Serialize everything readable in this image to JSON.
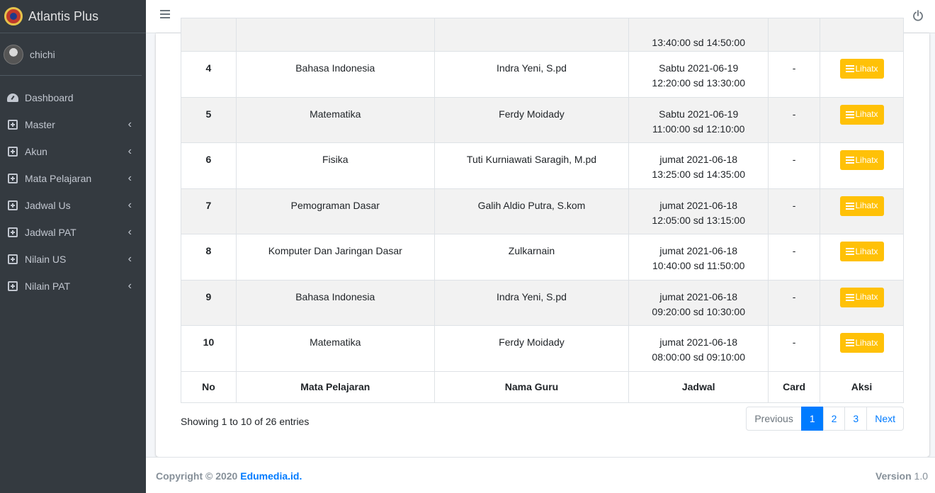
{
  "brand": {
    "title": "Atlantis Plus"
  },
  "user": {
    "name": "chichi"
  },
  "sidebar": {
    "items": [
      {
        "label": "Dashboard",
        "icon": "tachometer-icon",
        "has_chevron": false
      },
      {
        "label": "Master",
        "icon": "plus-square-icon",
        "has_chevron": true
      },
      {
        "label": "Akun",
        "icon": "plus-square-icon",
        "has_chevron": true
      },
      {
        "label": "Mata Pelajaran",
        "icon": "plus-square-icon",
        "has_chevron": true
      },
      {
        "label": "Jadwal Us",
        "icon": "plus-square-icon",
        "has_chevron": true
      },
      {
        "label": "Jadwal PAT",
        "icon": "plus-square-icon",
        "has_chevron": true
      },
      {
        "label": "Nilain US",
        "icon": "plus-square-icon",
        "has_chevron": true
      },
      {
        "label": "Nilain PAT",
        "icon": "plus-square-icon",
        "has_chevron": true
      }
    ]
  },
  "table": {
    "columns": [
      "No",
      "Mata Pelajaran",
      "Nama Guru",
      "Jadwal",
      "Card",
      "Aksi"
    ],
    "partial_row": {
      "jadwal_line2": "13:40:00 sd 14:50:00"
    },
    "rows": [
      {
        "no": "4",
        "mapel": "Bahasa Indonesia",
        "guru": "Indra Yeni, S.pd",
        "jadwal1": "Sabtu 2021-06-19",
        "jadwal2": "12:20:00 sd 13:30:00",
        "card": "-",
        "aksi": "Lihatx"
      },
      {
        "no": "5",
        "mapel": "Matematika",
        "guru": "Ferdy Moidady",
        "jadwal1": "Sabtu 2021-06-19",
        "jadwal2": "11:00:00 sd 12:10:00",
        "card": "-",
        "aksi": "Lihatx"
      },
      {
        "no": "6",
        "mapel": "Fisika",
        "guru": "Tuti Kurniawati Saragih, M.pd",
        "jadwal1": "jumat 2021-06-18",
        "jadwal2": "13:25:00 sd 14:35:00",
        "card": "-",
        "aksi": "Lihatx"
      },
      {
        "no": "7",
        "mapel": "Pemograman Dasar",
        "guru": "Galih Aldio Putra, S.kom",
        "jadwal1": "jumat 2021-06-18",
        "jadwal2": "12:05:00 sd 13:15:00",
        "card": "-",
        "aksi": "Lihatx"
      },
      {
        "no": "8",
        "mapel": "Komputer Dan Jaringan Dasar",
        "guru": "Zulkarnain",
        "jadwal1": "jumat 2021-06-18",
        "jadwal2": "10:40:00 sd 11:50:00",
        "card": "-",
        "aksi": "Lihatx"
      },
      {
        "no": "9",
        "mapel": "Bahasa Indonesia",
        "guru": "Indra Yeni, S.pd",
        "jadwal1": "jumat 2021-06-18",
        "jadwal2": "09:20:00 sd 10:30:00",
        "card": "-",
        "aksi": "Lihatx"
      },
      {
        "no": "10",
        "mapel": "Matematika",
        "guru": "Ferdy Moidady",
        "jadwal1": "jumat 2021-06-18",
        "jadwal2": "08:00:00 sd 09:10:00",
        "card": "-",
        "aksi": "Lihatx"
      }
    ],
    "info": "Showing 1 to 10 of 26 entries"
  },
  "pagination": {
    "previous": "Previous",
    "pages": [
      "1",
      "2",
      "3"
    ],
    "active_page": "1",
    "next": "Next"
  },
  "footer": {
    "copyright_prefix": "Copyright © 2020",
    "copyright_link": "Edumedia.id.",
    "version_label": "Version",
    "version_number": "1.0"
  },
  "colors": {
    "sidebar_bg": "#343a40",
    "accent": "#007bff",
    "warning": "#ffc107"
  }
}
